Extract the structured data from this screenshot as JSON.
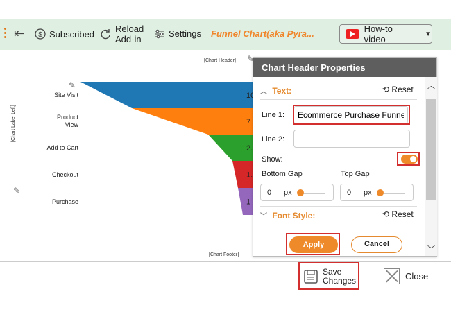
{
  "toolbar": {
    "subscribed": "Subscribed",
    "reload_line1": "Reload",
    "reload_line2": "Add-in",
    "settings": "Settings",
    "chart_title": "Funnel Chart(aka Pyra...",
    "howto": "How-to video"
  },
  "chart": {
    "header_placeholder": "[Chart Header]",
    "footer_placeholder": "[Chart Footer]",
    "label_left_placeholder": "[Chart Label Left]",
    "stages": [
      {
        "line1": "Site Visit",
        "line2": "",
        "value": "10",
        "color": "#1f77b4"
      },
      {
        "line1": "Product",
        "line2": "View",
        "value": "7",
        "color": "#ff7f0e"
      },
      {
        "line1": "Add to Cart",
        "line2": "",
        "value": "2.",
        "color": "#2ca02c"
      },
      {
        "line1": "Checkout",
        "line2": "",
        "value": "1.",
        "color": "#d62728"
      },
      {
        "line1": "Purchase",
        "line2": "",
        "value": "1",
        "color": "#9467bd"
      }
    ]
  },
  "panel": {
    "title": "Chart Header Properties",
    "text_section": "Text:",
    "reset": "Reset",
    "line1_label": "Line 1:",
    "line1_value": "Ecommerce Purchase Funnel",
    "line2_label": "Line 2:",
    "line2_value": "",
    "show_label": "Show:",
    "show_on": true,
    "bottom_gap_label": "Bottom Gap",
    "top_gap_label": "Top Gap",
    "bottom_gap_value": "0",
    "top_gap_value": "0",
    "unit": "px",
    "font_section": "Font Style:",
    "font_reset": "Reset",
    "apply": "Apply",
    "cancel": "Cancel"
  },
  "footer": {
    "save_line1": "Save",
    "save_line2": "Changes",
    "close": "Close"
  },
  "colors": {
    "accent": "#ef8a2b",
    "toolbar_bg": "#dff0e2",
    "highlight": "#d32f2f"
  }
}
